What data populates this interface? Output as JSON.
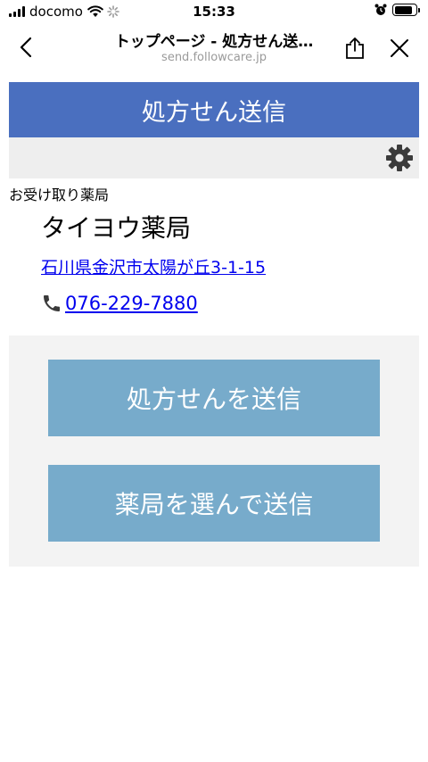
{
  "status_bar": {
    "carrier": "docomo",
    "time": "15:33",
    "battery_level": 0.85
  },
  "nav": {
    "title": "トップページ - 処方せん送…",
    "url": "send.followcare.jp",
    "icons": [
      "chevron-left-icon",
      "share-icon",
      "close-icon"
    ]
  },
  "header": {
    "title": "処方せん送信"
  },
  "pharmacy": {
    "caption": "お受け取り薬局",
    "name": "タイヨウ薬局",
    "address": "石川県金沢市太陽が丘3-1-15",
    "phone": "076-229-7880"
  },
  "actions": {
    "send_label": "処方せんを送信",
    "select_label": "薬局を選んで送信"
  },
  "colors": {
    "banner": "#4a6fbf",
    "button": "#77abcb",
    "link": "#0000ee",
    "panel": "#f3f3f3"
  }
}
